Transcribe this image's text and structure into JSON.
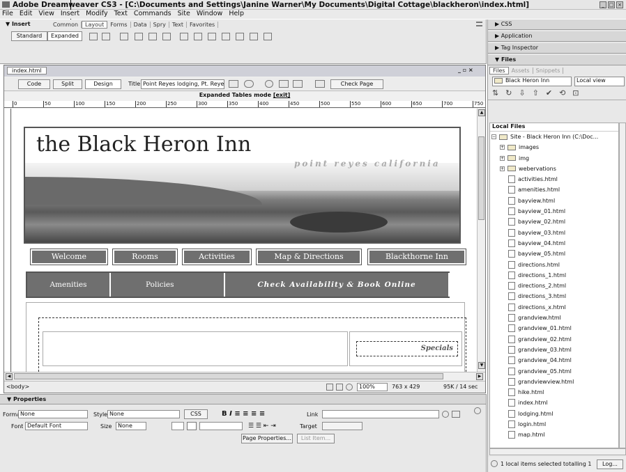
{
  "window": {
    "title": "Adobe Dreamweaver CS3 - [C:\\Documents and Settings\\Janine Warner\\My Documents\\Digital Cottage\\blackheron\\index.html]"
  },
  "menu": [
    "File",
    "Edit",
    "View",
    "Insert",
    "Modify",
    "Text",
    "Commands",
    "Site",
    "Window",
    "Help"
  ],
  "insert": {
    "title": "▼ Insert",
    "tabs": [
      "Common",
      "Layout",
      "Forms",
      "Data",
      "Spry",
      "Text",
      "Favorites"
    ],
    "standard": "Standard",
    "expanded": "Expanded"
  },
  "doc": {
    "tab": "index.html",
    "code": "Code",
    "split": "Split",
    "design": "Design",
    "title_label": "Title:",
    "title_value": "Point Reyes lodging, Pt. Reye:",
    "check_page": "Check Page",
    "expanded_mode": "Expanded Tables mode",
    "exit": "[exit]",
    "ruler": [
      "0",
      "50",
      "100",
      "150",
      "200",
      "250",
      "300",
      "350",
      "400",
      "450",
      "500",
      "550",
      "600",
      "650",
      "700",
      "750"
    ]
  },
  "site": {
    "title": "the Black Heron Inn",
    "tagline": "point reyes california",
    "nav1": [
      "Welcome",
      "Rooms",
      "Activities",
      "Map & Directions",
      "Blackthorne Inn"
    ],
    "nav2": [
      "Amenities",
      "Policies",
      "Check Availability & Book Online"
    ],
    "specials": "Specials"
  },
  "status": {
    "tag": "<body>",
    "zoom": "100%",
    "size": "763 x 429",
    "download": "95K / 14 sec"
  },
  "properties": {
    "title": "▼ Properties",
    "format_label": "Format",
    "format": "None",
    "style_label": "Style",
    "style": "None",
    "css": "CSS",
    "link_label": "Link",
    "font_label": "Font",
    "font": "Default Font",
    "size_label": "Size",
    "size": "None",
    "target_label": "Target",
    "page_props": "Page Properties...",
    "list_item": "List Item..."
  },
  "right": {
    "css": "▶ CSS",
    "application": "▶ Application",
    "tag_inspector": "▶ Tag Inspector",
    "files_head": "▼ Files",
    "tabs": [
      "Files",
      "Assets",
      "Snippets"
    ],
    "site_select": "Black Heron Inn",
    "view_select": "Local view",
    "local_files": "Local Files",
    "site_root": "Site - Black Heron Inn (C:\\Doc...",
    "folders": [
      "images",
      "img",
      "webervations"
    ],
    "files": [
      "activities.html",
      "amenities.html",
      "bayview.html",
      "bayview_01.html",
      "bayview_02.html",
      "bayview_03.html",
      "bayview_04.html",
      "bayview_05.html",
      "directions.html",
      "directions_1.html",
      "directions_2.html",
      "directions_3.html",
      "directions_x.html",
      "grandview.html",
      "grandview_01.html",
      "grandview_02.html",
      "grandview_03.html",
      "grandview_04.html",
      "grandview_05.html",
      "grandviewview.html",
      "hike.html",
      "index.html",
      "lodging.html",
      "login.html",
      "map.html"
    ],
    "status": "1 local items selected totalling 1",
    "log": "Log..."
  }
}
